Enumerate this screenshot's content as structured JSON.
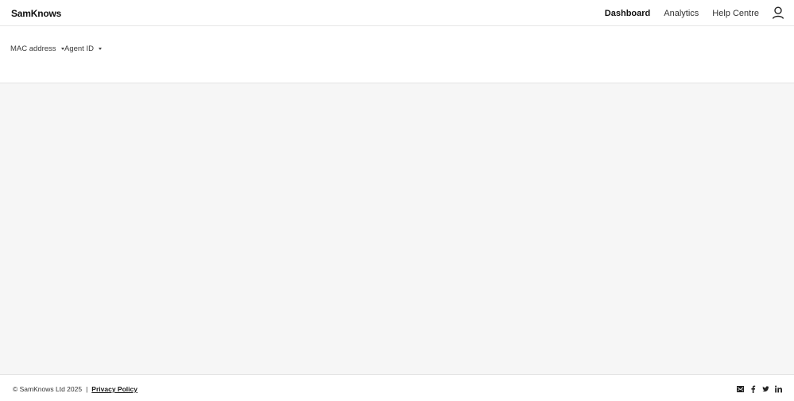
{
  "header": {
    "logo": "SamKnows",
    "nav": [
      {
        "label": "Dashboard",
        "active": true
      },
      {
        "label": "Analytics",
        "active": false
      },
      {
        "label": "Help Centre",
        "active": false
      }
    ],
    "user_icon": "user-icon"
  },
  "filters": {
    "mac_address": "MAC address",
    "agent_id": "Agent ID"
  },
  "footer": {
    "copyright": "© SamKnows Ltd 2025",
    "separator": "|",
    "privacy": "Privacy Policy",
    "social_icons": [
      "email-icon",
      "facebook-icon",
      "twitter-icon",
      "linkedin-icon"
    ]
  },
  "colors": {
    "content_bg": "#f6f6f6",
    "border": "#e3e3e3",
    "text": "#1a1a1a"
  }
}
